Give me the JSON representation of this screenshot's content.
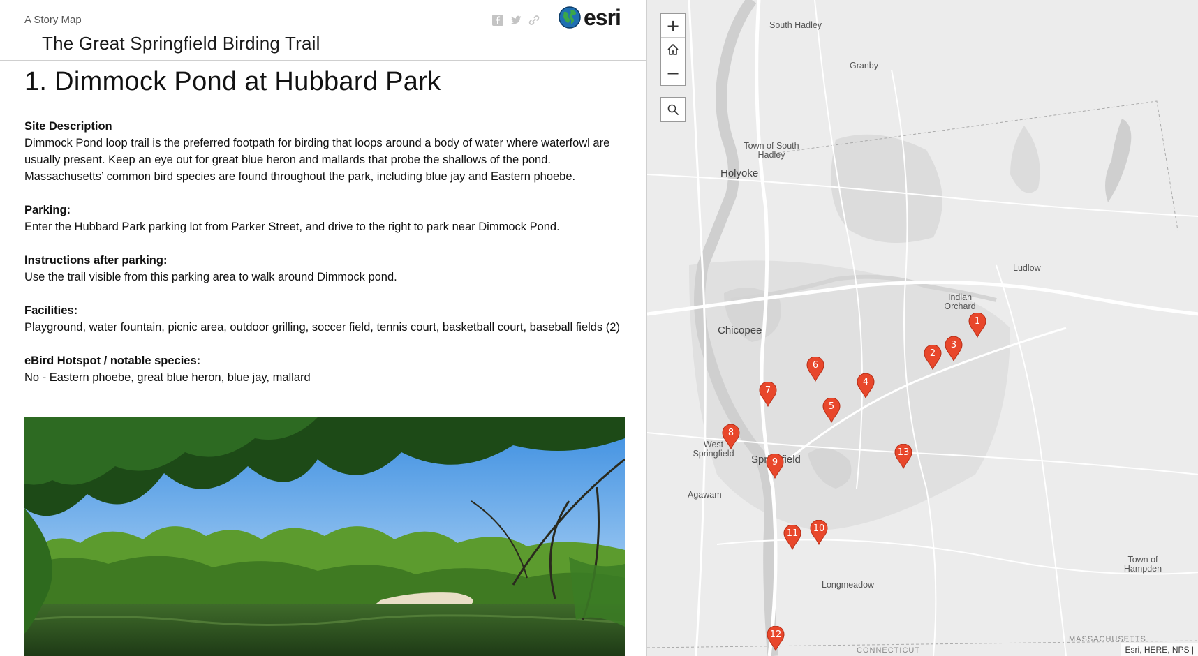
{
  "header": {
    "subtitle": "A Story Map",
    "title": "The Great Springfield Birding Trail",
    "share_icons": [
      "facebook-icon",
      "twitter-icon",
      "link-icon"
    ],
    "logo_text": "esri"
  },
  "entry": {
    "heading": "1. Dimmock Pond at Hubbard Park",
    "sections": [
      {
        "label": "Site Description",
        "text": "Dimmock Pond loop trail is the preferred footpath for birding that loops around a body of water where waterfowl are usually present. Keep an eye out for great blue heron and mallards that probe the shallows of the pond. Massachusetts’ common bird species are found throughout the park, including blue jay and Eastern phoebe."
      },
      {
        "label": "Parking:",
        "text": "Enter the Hubbard Park parking lot from Parker Street, and drive to the right to park near Dimmock Pond."
      },
      {
        "label": "Instructions after parking:",
        "text": "Use the trail visible from this parking area to walk around Dimmock pond."
      },
      {
        "label": "Facilities:",
        "text": "Playground, water fountain, picnic area, outdoor grilling, soccer field, tennis court, basketball court, baseball fields (2)"
      },
      {
        "label": "eBird Hotspot / notable species:",
        "text": "No - Eastern phoebe, great blue heron, blue jay, mallard"
      }
    ]
  },
  "map": {
    "controls": {
      "zoom_in": "+",
      "home": "home-icon",
      "zoom_out": "−",
      "search": "search-icon"
    },
    "places": {
      "south_hadley": "South Hadley",
      "granby": "Granby",
      "town_south_hadley": "Town of South Hadley",
      "holyoke": "Holyoke",
      "ludlow": "Ludlow",
      "indian_orchard": "Indian Orchard",
      "chicopee": "Chicopee",
      "west_springfield": "West Springfield",
      "springfield": "Springfield",
      "agawam": "Agawam",
      "longmeadow": "Longmeadow",
      "town_hampden": "Town of Hampden",
      "massachusetts": "MASSACHUSETTS",
      "connecticut": "CONNECTICUT"
    },
    "markers": [
      "1",
      "2",
      "3",
      "4",
      "5",
      "6",
      "7",
      "8",
      "9",
      "10",
      "11",
      "12",
      "13"
    ],
    "marker_color": "#e8472b",
    "attribution": "Esri, HERE, NPS |"
  }
}
